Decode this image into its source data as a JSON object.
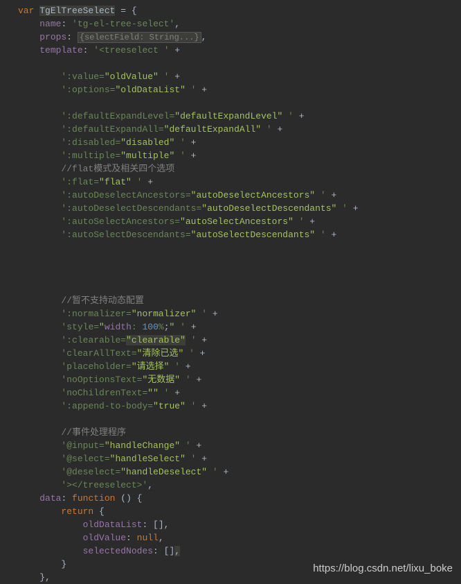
{
  "code": {
    "l1_var": "var",
    "l1_name": "TgElTreeSelect",
    "l1_eq": " = {",
    "l2_key": "name",
    "l2_val": "'tg-el-tree-select'",
    "l3_key": "props",
    "l3_val": "{selectField: String...}",
    "l4_key": "template",
    "l4_q": "'",
    "l4_tag": "<treeselect ",
    "l4_end": " +",
    "l5_q": "'",
    "l5_attr": ":value=",
    "l5_val": "\"oldValue\"",
    "l5_end": " ' +",
    "l6_q": "'",
    "l6_attr": ":options=",
    "l6_val": "\"oldDataList\"",
    "l6_end": " ' +",
    "l7_q": "'",
    "l7_attr": ":defaultExpandLevel=",
    "l7_val": "\"defaultExpandLevel\"",
    "l7_end": " ' +",
    "l8_q": "'",
    "l8_attr": ":defaultExpandAll=",
    "l8_val": "\"defaultExpandAll\"",
    "l8_end": " ' +",
    "l9_q": "'",
    "l9_attr": ":disabled=",
    "l9_val": "\"disabled\"",
    "l9_end": " ' +",
    "l10_q": "'",
    "l10_attr": ":multiple=",
    "l10_val": "\"multiple\"",
    "l10_end": " ' +",
    "l11_comment": "//flat模式及相关四个选项",
    "l12_q": "'",
    "l12_attr": ":flat=",
    "l12_val": "\"flat\"",
    "l12_end": " ' +",
    "l13_q": "'",
    "l13_attr": ":autoDeselectAncestors=",
    "l13_val": "\"autoDeselectAncestors\"",
    "l13_end": " ' +",
    "l14_q": "'",
    "l14_attr": ":autoDeselectDescendants=",
    "l14_val": "\"autoDeselectDescendants\"",
    "l14_end": " ' +",
    "l15_q": "'",
    "l15_attr": ":autoSelectAncestors=",
    "l15_val": "\"autoSelectAncestors\"",
    "l15_end": " ' +",
    "l16_q": "'",
    "l16_attr": ":autoSelectDescendants=",
    "l16_val": "\"autoSelectDescendants\"",
    "l16_end": " ' +",
    "l17_comment": "//暂不支持动态配置",
    "l18_q": "'",
    "l18_attr": ":normalizer=",
    "l18_val": "\"normalizer\"",
    "l18_end": " ' +",
    "l19_q": "'",
    "l19_attr": "style=",
    "l19_valq": "\"",
    "l19_prop": "width",
    "l19_colon": ": ",
    "l19_num": "100",
    "l19_unit": "%",
    "l19_semi": ";",
    "l19_valq2": "\"",
    "l19_end": " ' +",
    "l20_q": "'",
    "l20_attr": ":clearable=",
    "l20_val": "\"clearable\"",
    "l20_end": " ' +",
    "l21_q": "'",
    "l21_attr": "clearAllText=",
    "l21_val": "\"清除已选\"",
    "l21_end": " ' +",
    "l22_q": "'",
    "l22_attr": "placeholder=",
    "l22_val": "\"请选择\"",
    "l22_end": " ' +",
    "l23_q": "'",
    "l23_attr": "noOptionsText=",
    "l23_val": "\"无数据\"",
    "l23_end": " ' +",
    "l24_q": "'",
    "l24_attr": "noChildrenText=",
    "l24_val": "\"\"",
    "l24_end": " ' +",
    "l25_q": "'",
    "l25_attr": ":append-to-body=",
    "l25_val": "\"true\"",
    "l25_end": " ' +",
    "l26_comment": "//事件处理程序",
    "l27_q": "'",
    "l27_attr": "@input=",
    "l27_val": "\"handleChange\"",
    "l27_end": " ' +",
    "l28_q": "'",
    "l28_attr": "@select=",
    "l28_val": "\"handleSelect\"",
    "l28_end": " ' +",
    "l29_q": "'",
    "l29_attr": "@deselect=",
    "l29_val": "\"handleDeselect\"",
    "l29_end": " ' +",
    "l30_q": "'",
    "l30_tag": ">",
    "l30_close": "</treeselect>",
    "l30_q2": "'",
    "l30_comma": ",",
    "l31_key": "data",
    "l31_func": "function",
    "l31_paren": " () {",
    "l32_return": "return",
    "l32_brace": " {",
    "l33_key": "oldDataList",
    "l33_val": ": [],",
    "l34_key": "oldValue",
    "l34_colon": ": ",
    "l34_null": "null",
    "l34_comma": ",",
    "l35_key": "selectedNodes",
    "l35_val": ": []",
    "l35_comma": ",",
    "l36": "}",
    "l37": "},"
  },
  "watermark": "https://blog.csdn.net/lixu_boke"
}
